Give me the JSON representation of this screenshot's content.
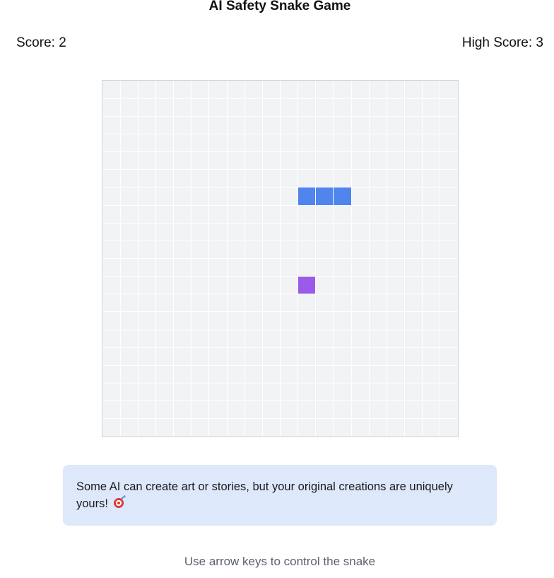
{
  "title": "AI Safety Snake Game",
  "score": {
    "label": "Score: 2",
    "value": 2
  },
  "high_score": {
    "label": "High Score: 3",
    "value": 3
  },
  "board": {
    "grid_columns": 20,
    "grid_rows": 20,
    "snake": [
      [
        11,
        6
      ],
      [
        12,
        6
      ],
      [
        13,
        6
      ]
    ],
    "food": [
      11,
      11
    ],
    "colors": {
      "background": "#f2f3f5",
      "grid": "#ffffff",
      "snake": "#4f85ec",
      "food": "#9b5bea"
    }
  },
  "message": {
    "text": "Some AI can create art or stories, but your original creations are uniquely yours!",
    "icon": "target-icon"
  },
  "hint": "Use arrow keys to control the snake"
}
